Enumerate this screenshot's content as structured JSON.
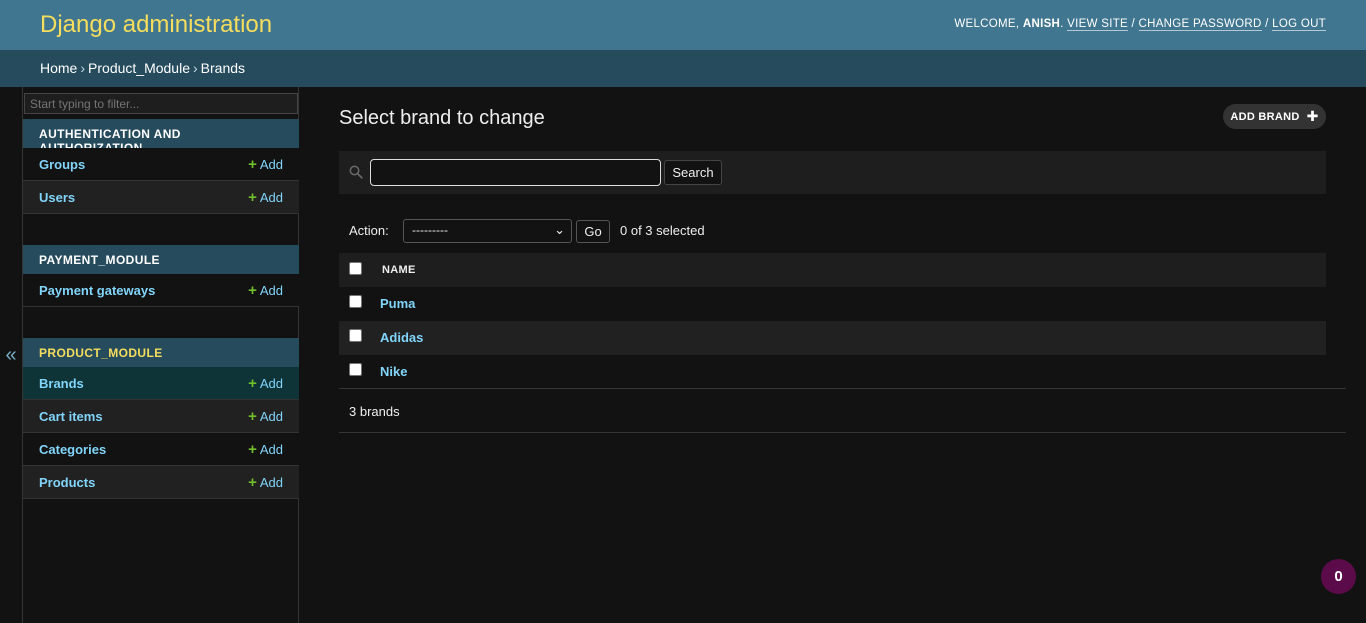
{
  "header": {
    "site_name": "Django administration",
    "welcome": "Welcome,",
    "username": "Anish",
    "view_site": "View site",
    "change_password": "Change password",
    "log_out": "Log out"
  },
  "breadcrumbs": {
    "home": "Home",
    "app": "Product_Module",
    "current": "Brands",
    "separator": "›"
  },
  "sidebar": {
    "toggle": "«",
    "filter_placeholder": "Start typing to filter...",
    "add_label": "Add",
    "modules": [
      {
        "caption": "Authentication and Authorization",
        "models": [
          {
            "name": "Groups"
          },
          {
            "name": "Users"
          }
        ]
      },
      {
        "caption": "Payment_Module",
        "models": [
          {
            "name": "Payment gateways"
          }
        ]
      },
      {
        "caption": "Product_Module",
        "models": [
          {
            "name": "Brands",
            "current": true
          },
          {
            "name": "Cart items"
          },
          {
            "name": "Categories"
          },
          {
            "name": "Products"
          }
        ]
      }
    ]
  },
  "main": {
    "title": "Select brand to change",
    "add_button": "ADD BRAND",
    "search": {
      "value": "",
      "button": "Search"
    },
    "actions": {
      "label": "Action:",
      "selected_option": "---------",
      "go": "Go",
      "selected_count": "0 of 3 selected"
    },
    "table": {
      "column": "NAME",
      "rows": [
        "Puma",
        "Adidas",
        "Nike"
      ]
    },
    "footer": "3 brands"
  },
  "debug_toolbar": {
    "badge": "0"
  },
  "colors": {
    "header_bg": "#417690",
    "breadcrumbs_bg": "#264b5d",
    "site_name": "#f5dd5d",
    "link": "#81d4fa",
    "add_plus": "#70bf2b",
    "badge_bg": "#5c0b4a"
  }
}
